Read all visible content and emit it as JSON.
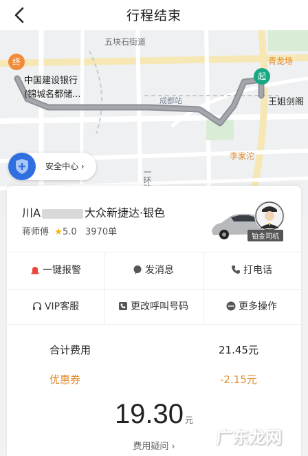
{
  "header": {
    "title": "行程结束",
    "back_icon": "chevron-left-icon"
  },
  "map": {
    "labels": {
      "street": "五块石街道",
      "dragon": "青龙场",
      "end_name_1": "中国建设银行",
      "end_name_2": "(锦城名都储...",
      "station": "成都站",
      "start_name": "王姐剑阁",
      "lijiatuo": "李家沱",
      "road": "一环路"
    },
    "end_pin": "终",
    "start_pin": "起",
    "route_color": "#8c9096"
  },
  "safety": {
    "label": "安全中心",
    "chevron": "›"
  },
  "driver": {
    "plate_prefix": "川A",
    "car_model": "大众新捷达·银色",
    "name": "蒋师傅",
    "star": "★",
    "rating": "5.0",
    "orders": "3970单",
    "badge": "铂金司机"
  },
  "actions": [
    {
      "label": "一键报警",
      "icon": "alarm-icon"
    },
    {
      "label": "发消息",
      "icon": "message-icon"
    },
    {
      "label": "打电话",
      "icon": "phone-icon"
    },
    {
      "label": "VIP客服",
      "icon": "headset-icon"
    },
    {
      "label": "更改呼叫号码",
      "icon": "phone-number-icon"
    },
    {
      "label": "更多操作",
      "icon": "more-icon"
    }
  ],
  "fees": {
    "total_label": "合计费用",
    "total_value": "21.45元",
    "discount_label": "优惠券",
    "discount_value": "-2.15元",
    "paid": "19.30",
    "paid_unit": "元",
    "question": "费用疑问 ›"
  },
  "watermark": "广东龙网",
  "colors": {
    "accent_orange": "#e08a2c",
    "safety_blue": "#2f6fe0",
    "start_green": "#19a886",
    "end_orange": "#f08a3c"
  }
}
